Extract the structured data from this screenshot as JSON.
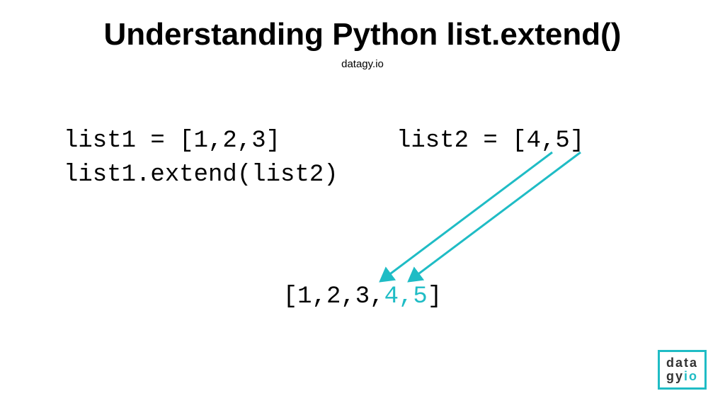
{
  "title": "Understanding Python list.extend()",
  "subtitle": "datagy.io",
  "code": {
    "line1_left": "list1 = [1,2,3]",
    "line2_left": "list1.extend(list2)",
    "line1_right": "list2 = [4,5]"
  },
  "result": {
    "prefix": "[1,2,3,",
    "highlight": "4,5",
    "suffix": "]"
  },
  "logo": {
    "line1": "data",
    "line2a": "gy",
    "line2b": "io"
  },
  "colors": {
    "teal": "#1fbcc5"
  }
}
